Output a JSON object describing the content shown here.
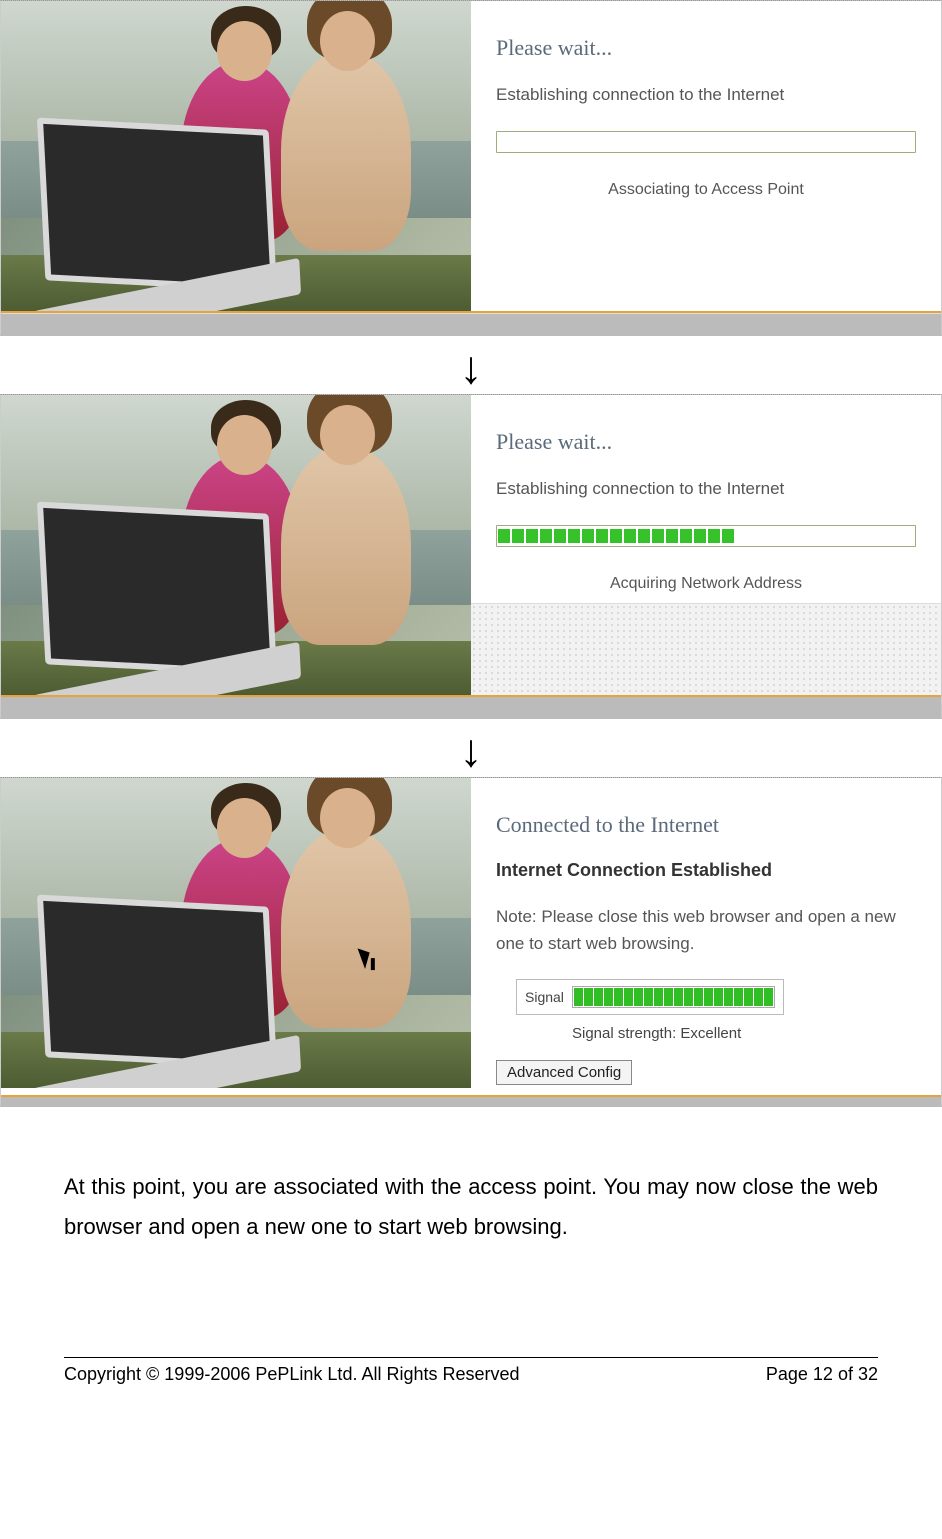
{
  "arrow_glyph": "↓",
  "step1": {
    "title": "Please wait...",
    "subtitle": "Establishing connection to the Internet",
    "caption": "Associating to Access Point",
    "progress_segments": 0
  },
  "step2": {
    "title": "Please wait...",
    "subtitle": "Establishing connection to the Internet",
    "caption": "Acquiring Network Address",
    "progress_segments": 17
  },
  "step3": {
    "title": "Connected to the Internet",
    "bold": "Internet Connection Established",
    "note": "Note: Please close this web browser and open a new one to start web browsing.",
    "signal_label": "Signal",
    "signal_bars": 20,
    "strength_label": "Signal strength: Excellent",
    "button_label": "Advanced Config"
  },
  "doc_paragraph": "At this point, you are associated with the access point.  You may now close the web browser and open a new one to start web browsing.",
  "footer": {
    "copyright": "Copyright © 1999-2006 PePLink Ltd. All Rights Reserved",
    "page_prefix": "Page ",
    "page_current": "12",
    "page_sep": " of ",
    "page_total": "32"
  }
}
